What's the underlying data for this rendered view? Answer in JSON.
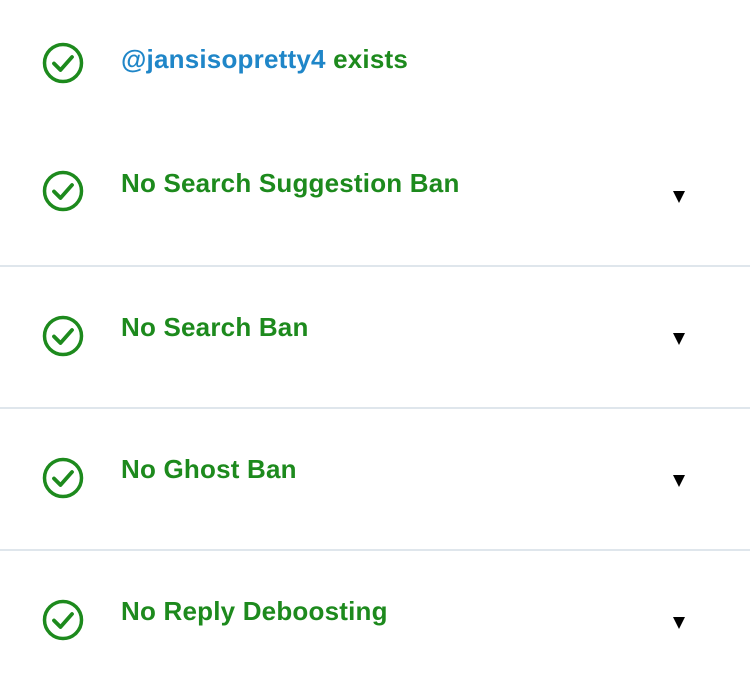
{
  "account": {
    "handle": "@jansisopretty4",
    "status": "exists",
    "icon": "check-circle-icon"
  },
  "checks": [
    {
      "label": "No Search Suggestion Ban",
      "icon": "check-circle-icon",
      "toggle_icon": "triangle-down-icon"
    },
    {
      "label": "No Search Ban",
      "icon": "check-circle-icon",
      "toggle_icon": "triangle-down-icon"
    },
    {
      "label": "No Ghost Ban",
      "icon": "check-circle-icon",
      "toggle_icon": "triangle-down-icon"
    },
    {
      "label": "No Reply Deboosting",
      "icon": "check-circle-icon",
      "toggle_icon": "triangle-down-icon"
    }
  ],
  "colors": {
    "success": "#1d8a1d",
    "handle": "#1f86c8",
    "divider": "#dfe6ec",
    "caret": "#000000"
  }
}
